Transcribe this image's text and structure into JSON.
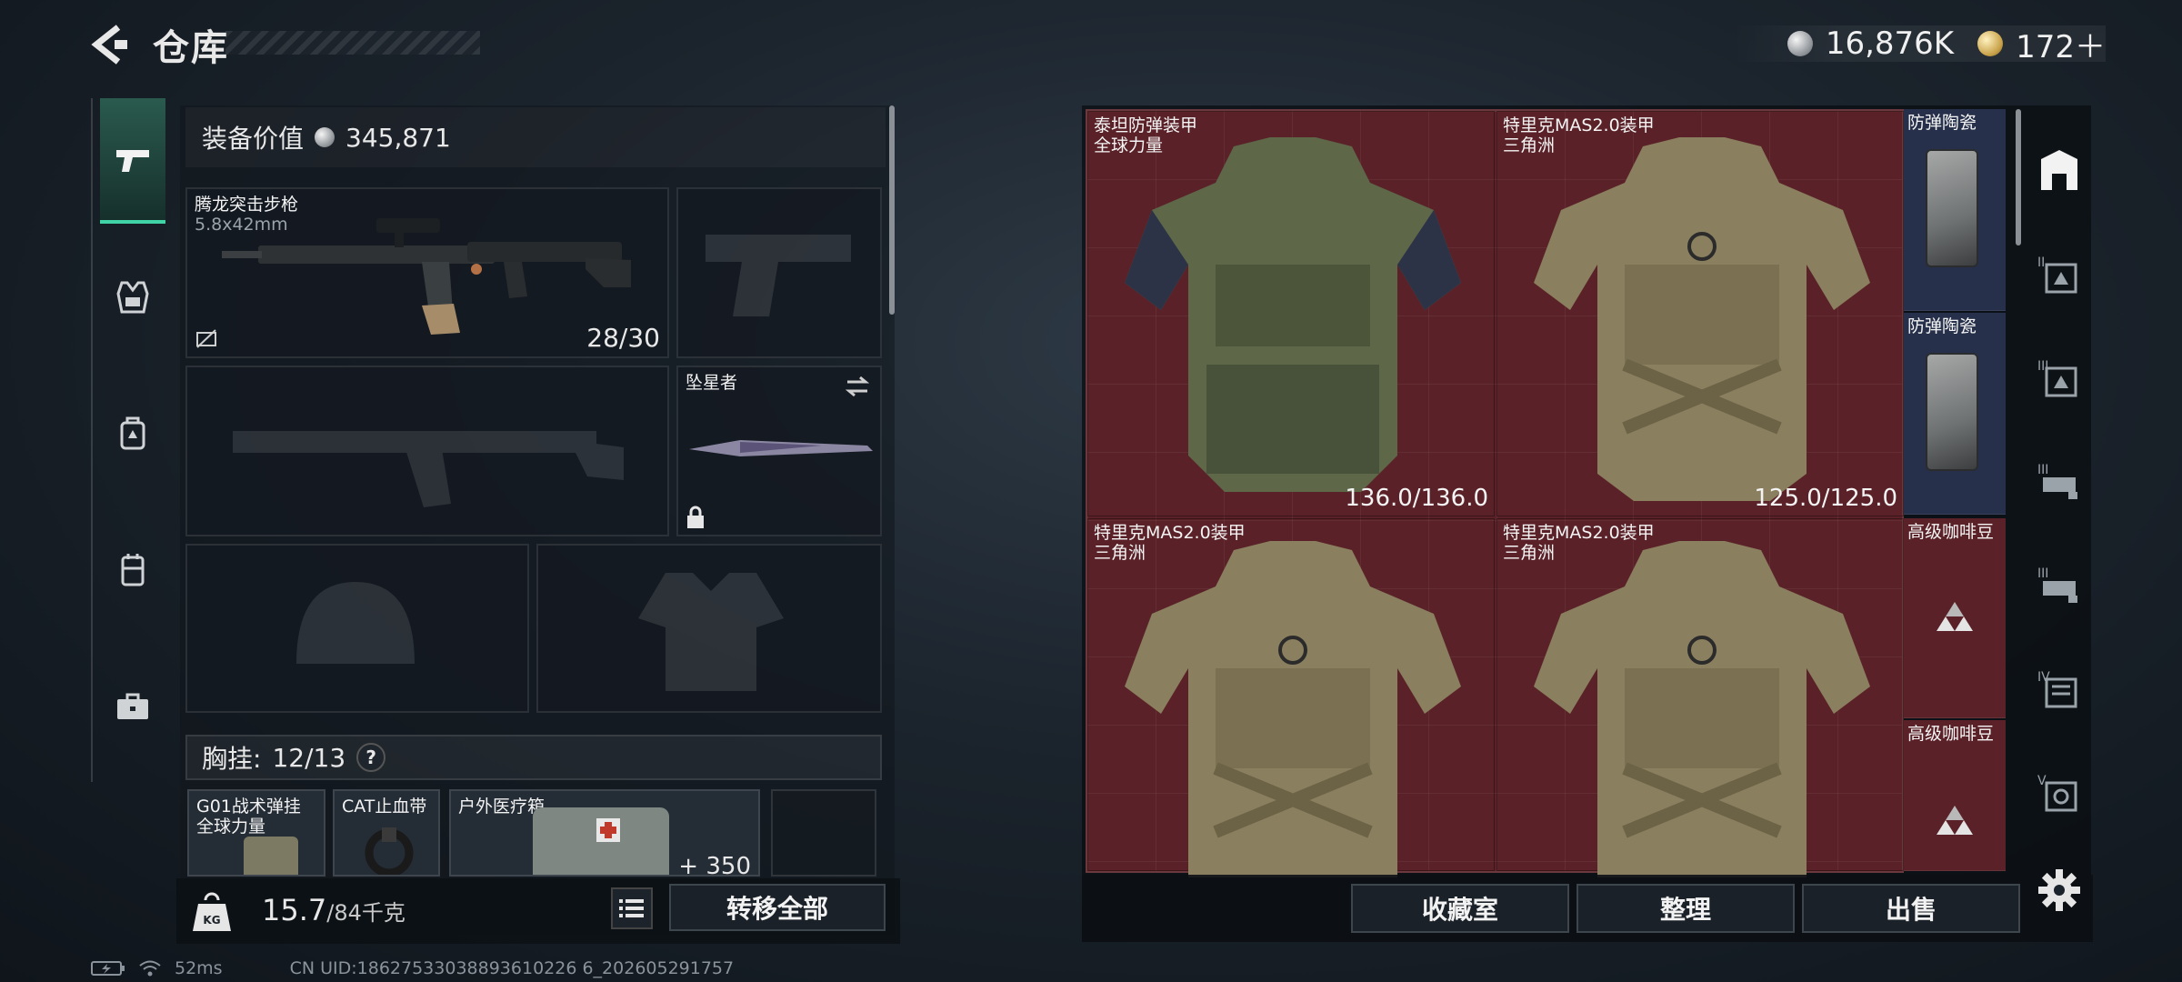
{
  "header": {
    "title": "仓库",
    "currency_primary": "16,876K",
    "currency_secondary": "172＋"
  },
  "left_sidebar": {
    "categories": [
      {
        "icon": "pistol-icon",
        "active": true
      },
      {
        "icon": "armor-vest-icon",
        "active": false
      },
      {
        "icon": "backpack-icon",
        "active": false
      },
      {
        "icon": "chest-rig-icon",
        "active": false
      },
      {
        "icon": "toolbox-icon",
        "active": false
      }
    ]
  },
  "loadout": {
    "value_label": "装备价值",
    "value": "345,871",
    "primary_weapon": {
      "name": "腾龙突击步枪",
      "caliber": "5.8x42mm",
      "ammo": "28/30"
    },
    "melee": {
      "name": "坠星者"
    },
    "chest_rig": {
      "label": "胸挂:",
      "capacity": "12/13",
      "help": "?"
    },
    "rig_items": [
      {
        "name": "G01战术弹挂",
        "sub": "全球力量"
      },
      {
        "name": "CAT止血带"
      },
      {
        "name": "户外医疗箱",
        "count": "350"
      }
    ],
    "weight": {
      "current": "15.7",
      "max": "/84千克"
    },
    "transfer_all": "转移全部"
  },
  "stash": {
    "items": [
      {
        "name": "泰坦防弹装甲",
        "sub": "全球力量",
        "durability": "136.0/136.0",
        "color": "#6f7a4e"
      },
      {
        "name": "特里克MAS2.0装甲",
        "sub": "三角洲",
        "durability": "125.0/125.0",
        "color": "#8f8566"
      },
      {
        "name": "特里克MAS2.0装甲",
        "sub": "三角洲",
        "durability": "",
        "color": "#8f8566"
      },
      {
        "name": "特里克MAS2.0装甲",
        "sub": "三角洲",
        "durability": "",
        "color": "#8f8566"
      }
    ],
    "side_items": [
      {
        "name": "防弹陶瓷"
      },
      {
        "name": "防弹陶瓷"
      },
      {
        "name": "高级咖啡豆"
      },
      {
        "name": "高级咖啡豆"
      }
    ],
    "buttons": {
      "collection": "收藏室",
      "organize": "整理",
      "sell": "出售"
    }
  },
  "right_sidebar": {
    "categories": [
      {
        "icon": "home-stash-icon"
      },
      {
        "icon": "stash-tab-ii-icon"
      },
      {
        "icon": "stash-tab-iii-icon"
      },
      {
        "icon": "stash-tab-iii-b-icon"
      },
      {
        "icon": "stash-tab-iii-c-icon"
      },
      {
        "icon": "stash-tab-iv-icon"
      },
      {
        "icon": "stash-tab-v-icon"
      }
    ]
  },
  "status": {
    "ping": "52ms",
    "uid": "CN UID:18627533038893610226 6_202605291757"
  }
}
